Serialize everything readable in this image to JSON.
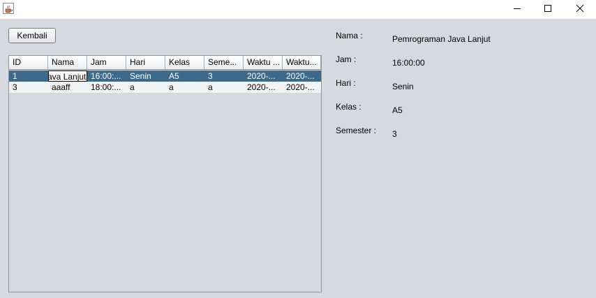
{
  "window": {
    "app_icon": "java-cup-icon",
    "controls": [
      "minimize-icon",
      "maximize-icon",
      "close-icon"
    ]
  },
  "back_button": {
    "label": "Kembali"
  },
  "table": {
    "columns": [
      "ID",
      "Nama",
      "Jam",
      "Hari",
      "Kelas",
      "Seme...",
      "Waktu ...",
      "Waktu..."
    ],
    "rows": [
      {
        "cells": [
          "1",
          "ava Lanjut",
          "16:00:...",
          "Senin",
          "A5",
          "3",
          "2020-...",
          "2020-..."
        ],
        "selected": true
      },
      {
        "cells": [
          "3",
          "aaaff",
          "18:00:...",
          "a",
          "a",
          "a",
          "2020-...",
          "2020-..."
        ],
        "selected": false
      }
    ]
  },
  "details": [
    {
      "label": "Nama :",
      "value": "Pemrograman Java Lanjut"
    },
    {
      "label": "Jam :",
      "value": "16:00:00"
    },
    {
      "label": "Hari :",
      "value": "Senin"
    },
    {
      "label": "Kelas :",
      "value": "A5"
    },
    {
      "label": "Semester :",
      "value": "3"
    }
  ],
  "colors": {
    "background": "#d6d9df",
    "selection": "#3d6a8a",
    "titlebar": "#ffffff"
  }
}
